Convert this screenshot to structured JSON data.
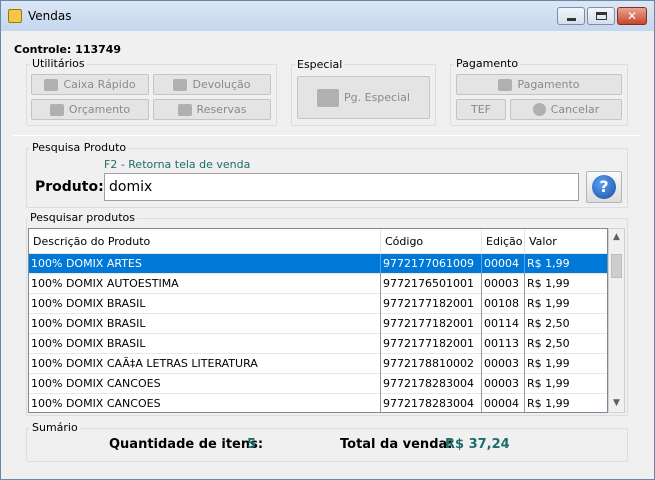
{
  "window": {
    "title": "Vendas"
  },
  "controle": "Controle: 113749",
  "utilitarios": {
    "label": "Utilitários",
    "caixa_rapido": "Caixa Rápido",
    "devolucao": "Devolução",
    "orcamento": "Orçamento",
    "reservas": "Reservas"
  },
  "especial": {
    "label": "Especial",
    "pg_especial": "Pg. Especial"
  },
  "pagamento": {
    "label": "Pagamento",
    "pagamento": "Pagamento",
    "tef": "TEF",
    "cancelar": "Cancelar"
  },
  "pesquisa": {
    "label": "Pesquisa Produto",
    "hint": "F2 - Retorna tela de venda",
    "produto_label": "Produto:",
    "produto_value": "domix"
  },
  "results": {
    "label": "Pesquisar produtos",
    "columns": [
      "Descrição do Produto",
      "Código",
      "Edição",
      "Valor"
    ],
    "rows": [
      [
        "100% DOMIX ARTES",
        "9772177061009",
        "00004",
        "R$ 1,99"
      ],
      [
        "100% DOMIX AUTOESTIMA",
        "9772176501001",
        "00003",
        "R$ 1,99"
      ],
      [
        "100% DOMIX BRASIL",
        "9772177182001",
        "00108",
        "R$ 1,99"
      ],
      [
        "100% DOMIX BRASIL",
        "9772177182001",
        "00114",
        "R$ 2,50"
      ],
      [
        "100% DOMIX BRASIL",
        "9772177182001",
        "00113",
        "R$ 2,50"
      ],
      [
        "100% DOMIX CAÃ‡A LETRAS LITERATURA",
        "9772178810002",
        "00003",
        "R$ 1,99"
      ],
      [
        "100% DOMIX CANCOES",
        "9772178283004",
        "00003",
        "R$ 1,99"
      ],
      [
        "100% DOMIX CANCOES",
        "9772178283004",
        "00004",
        "R$ 1,99"
      ]
    ]
  },
  "sumario": {
    "label": "Sumário",
    "qtd_label": "Quantidade de itens:",
    "qtd_value": "5",
    "total_label": "Total da venda:",
    "total_value": "R$ 37,24"
  }
}
